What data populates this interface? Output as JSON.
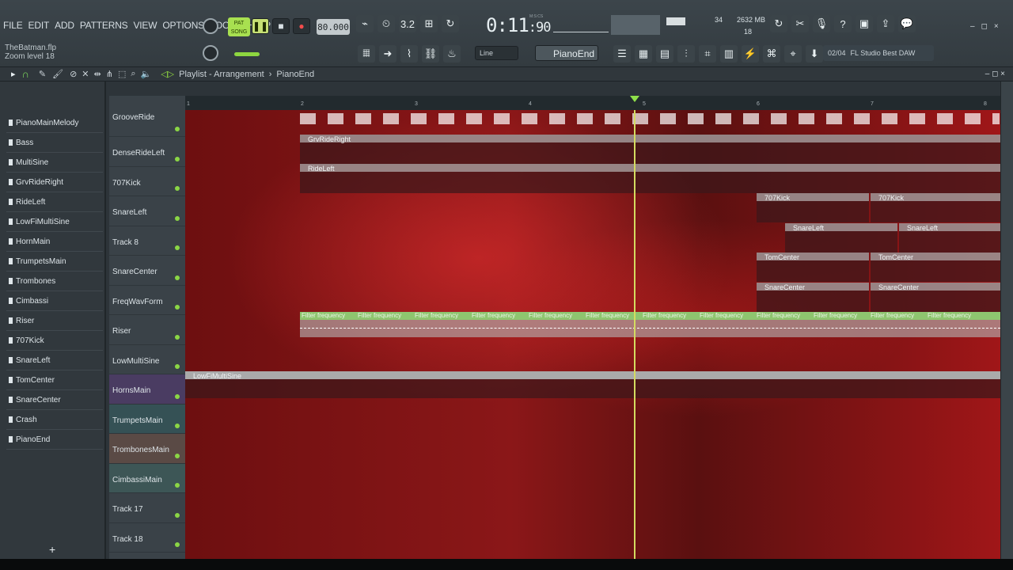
{
  "menu": [
    "FILE",
    "EDIT",
    "ADD",
    "PATTERNS",
    "VIEW",
    "OPTIONS",
    "TOOLS",
    "HELP"
  ],
  "project": {
    "file": "TheBatman.flp",
    "hint": "Zoom level 18"
  },
  "transport": {
    "mode_top": "PAT",
    "mode_bottom": "SONG",
    "tempo": "80.000",
    "time": "0:11",
    "time_sub": "90",
    "time_label": "M:S:CS"
  },
  "meter": {
    "cpu": "34",
    "mem": "2632 MB",
    "voices": "18"
  },
  "toolbar": {
    "snap": "Line",
    "pattern": "PianoEnd",
    "news_counter": "02/04",
    "news_text": "FL Studio Best DAW"
  },
  "playlist": {
    "title": "Playlist - Arrangement",
    "pattern": "PianoEnd"
  },
  "patterns": [
    "PianoMainMelody",
    "Bass",
    "MultiSine",
    "GrvRideRight",
    "RideLeft",
    "LowFiMultiSine",
    "HornMain",
    "TrumpetsMain",
    "Trombones",
    "Cimbassi",
    "Riser",
    "707Kick",
    "SnareLeft",
    "TomCenter",
    "SnareCenter",
    "Crash",
    "PianoEnd"
  ],
  "tracks": [
    "GrooveRide",
    "DenseRideLeft",
    "707Kick",
    "SnareLeft",
    "Track 8",
    "SnareCenter",
    "FreqWavForm",
    "Riser",
    "LowMultiSine",
    "HornsMain",
    "TrumpetsMain",
    "TrombonesMain",
    "CimbassiMain",
    "Track 17",
    "Track 18"
  ],
  "ruler": [
    "1",
    "2",
    "3",
    "4",
    "5",
    "6",
    "7",
    "8"
  ],
  "clips": {
    "grv": "GrvRideRight",
    "ride": "RideLeft",
    "kick": "707Kick",
    "snare": "SnareLeft",
    "tom": "TomCenter",
    "snarec": "SnareCenter",
    "filter": "Filter frequency",
    "lowfi": "LowFiMultiSine"
  },
  "icons": {
    "search": "search-icon",
    "settings": "gear-icon"
  }
}
